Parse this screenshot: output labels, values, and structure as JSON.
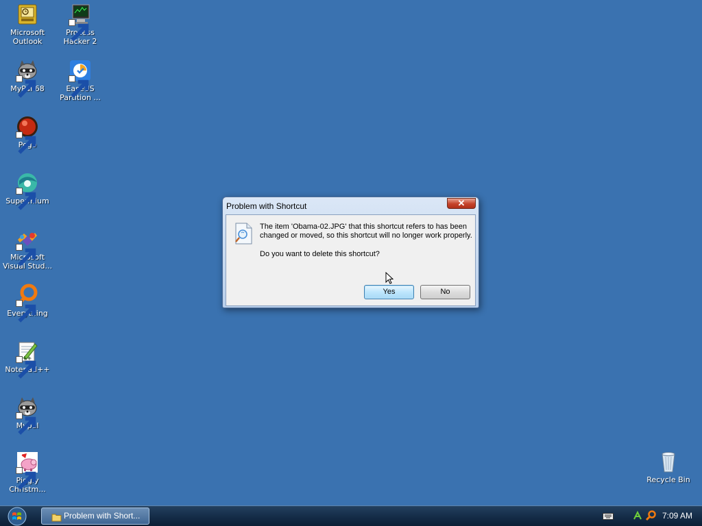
{
  "desktop": {
    "icons": [
      {
        "label": "Microsoft\nOutlook",
        "icon": "outlook-icon",
        "shortcut": false
      },
      {
        "label": "Process\nHacker 2",
        "icon": "process-hacker-icon",
        "shortcut": true
      },
      {
        "label": "MyPal 68",
        "icon": "raccoon-icon",
        "shortcut": true
      },
      {
        "label": "EaseUS\nPartition ...",
        "icon": "easeus-icon",
        "shortcut": true
      },
      {
        "label": "Pego",
        "icon": "pego-icon",
        "shortcut": true
      },
      {
        "label": "Supermium",
        "icon": "supermium-icon",
        "shortcut": true
      },
      {
        "label": "Microsoft\nVisual Stud...",
        "icon": "visual-studio-icon",
        "shortcut": true
      },
      {
        "label": "Everything",
        "icon": "everything-search-icon",
        "shortcut": true
      },
      {
        "label": "Notepad++",
        "icon": "notepad-plus-plus-icon",
        "shortcut": true
      },
      {
        "label": "Mypal",
        "icon": "raccoon-icon",
        "shortcut": true
      },
      {
        "label": "Piggly\nChristm...",
        "icon": "piggly-icon",
        "shortcut": true
      },
      {
        "label": "Recycle Bin",
        "icon": "recycle-bin-icon",
        "shortcut": false
      }
    ]
  },
  "dialog": {
    "title": "Problem with Shortcut",
    "close_label": "✕",
    "message": "The item 'Obama-02.JPG' that this shortcut refers to has been changed or moved, so this shortcut will no longer work properly.",
    "question": "Do you want to delete this shortcut?",
    "yes_label": "Yes",
    "no_label": "No"
  },
  "taskbar": {
    "task_label": "Problem with Short...",
    "clock": "7:09 AM"
  }
}
